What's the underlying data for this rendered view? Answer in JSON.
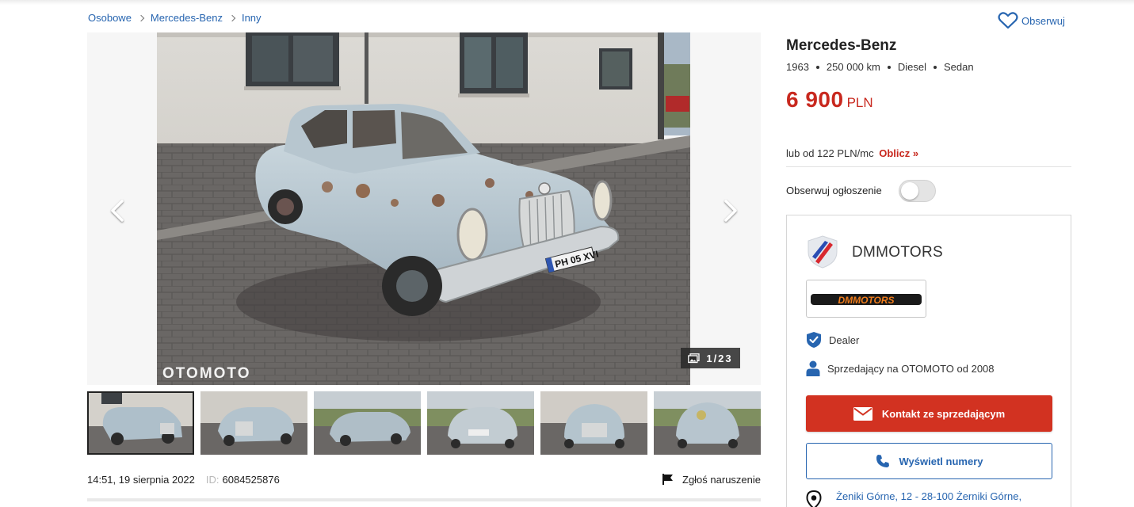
{
  "breadcrumb": [
    "Osobowe",
    "Mercedes-Benz",
    "Inny"
  ],
  "header": {
    "follow_label": "Obserwuj"
  },
  "gallery": {
    "counter": "1/23",
    "watermark": "OTOMOTO"
  },
  "meta": {
    "date": "14:51, 19 sierpnia 2022",
    "id_label": "ID:",
    "id_value": "6084525876",
    "report_label": "Zgłoś naruszenie"
  },
  "listing": {
    "title": "Mercedes-Benz",
    "specs": [
      "1963",
      "250 000 km",
      "Diesel",
      "Sedan"
    ],
    "price": "6 900",
    "currency": "PLN",
    "finance_prefix": "lub od ",
    "finance_amount": "122 PLN/mc",
    "finance_link": "Oblicz »"
  },
  "watch": {
    "label": "Obserwuj ogłoszenie",
    "enabled": false
  },
  "dealer": {
    "name": "DMMOTORS",
    "logo_text": "DMMOTORS",
    "badge": "Dealer",
    "since": "Sprzedający na OTOMOTO od 2008",
    "contact_button": "Kontakt ze sprzedającym",
    "phone_button": "Wyświetl numery",
    "location": "Żeniki Górne, 12 - 28-100 Żerniki Górne,"
  },
  "colors": {
    "accent_red": "#d23221",
    "price_red": "#c8281e",
    "link_blue": "#2765b0"
  }
}
